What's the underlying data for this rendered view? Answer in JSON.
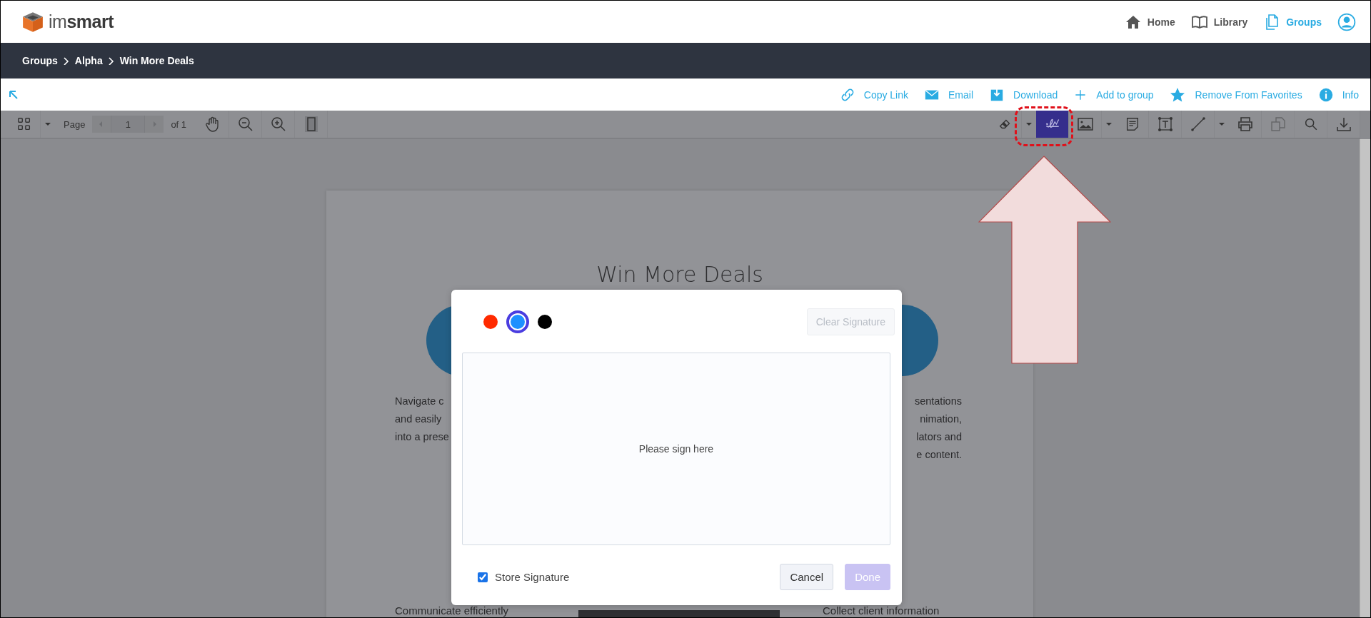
{
  "header": {
    "logo": "im**smart**",
    "nav": [
      {
        "label": "Home",
        "selected": false
      },
      {
        "label": "Library",
        "selected": false
      },
      {
        "label": "Groups",
        "selected": true
      }
    ]
  },
  "breadcrumb": [
    "Groups",
    "Alpha",
    "Win More Deals"
  ],
  "actions": [
    "Copy Link",
    "Email",
    "Download",
    "Add to group",
    "Remove From Favorites",
    "Info"
  ],
  "toolbar": {
    "page_label": "Page",
    "page": "1",
    "page_total": "of 1",
    "right_tools": [
      {
        "selected": false,
        "disabled": false
      },
      {
        "selected": false,
        "disabled": false
      },
      {
        "selected": true,
        "disabled": false
      },
      {
        "selected": false,
        "disabled": false
      },
      {
        "selected": false,
        "disabled": false
      },
      {
        "selected": false,
        "disabled": false
      },
      {
        "selected": false,
        "disabled": false
      },
      {
        "selected": false,
        "disabled": false
      },
      {
        "selected": false,
        "disabled": false
      },
      {
        "selected": false,
        "disabled": false
      },
      {
        "selected": false,
        "disabled": true
      },
      {
        "selected": false,
        "disabled": false
      },
      {
        "selected": false,
        "disabled": false
      }
    ]
  },
  "document": {
    "title": "Win More Deals",
    "left_lines": [
      "Navigate c",
      "and easily",
      "into a prese"
    ],
    "right_lines": [
      "sentations",
      "nimation,",
      "lators and",
      "e content."
    ],
    "bottom_left": "Communicate efficiently",
    "bottom_right": "Collect client information"
  },
  "dialog": {
    "colors": [
      {
        "color": "#ff2a00",
        "selected": false
      },
      {
        "color": "#1e90ff",
        "selected": true
      },
      {
        "color": "#000000",
        "selected": false
      }
    ],
    "clear_button": {
      "label": "Clear Signature",
      "disabled": true
    },
    "pad": {
      "placeholder": "Please sign here"
    },
    "store": {
      "label": "Store Signature",
      "checked": true
    },
    "buttons": [
      {
        "label": "Cancel",
        "kind": "secondary",
        "disabled": false
      },
      {
        "label": "Done",
        "kind": "primary",
        "disabled": true
      }
    ]
  }
}
